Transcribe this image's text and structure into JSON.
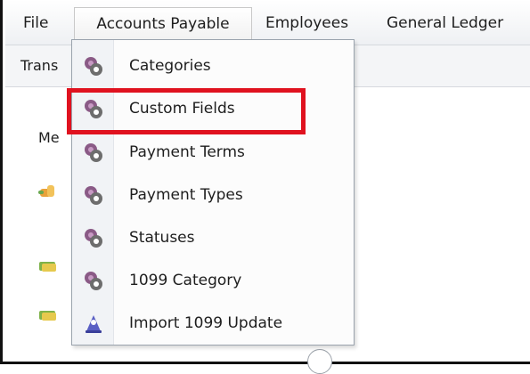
{
  "menubar": {
    "items": [
      {
        "label": "File"
      },
      {
        "label": "Accounts Payable"
      },
      {
        "label": "Employees"
      },
      {
        "label": "General Ledger"
      }
    ]
  },
  "toolbar": {
    "trans_label": "Trans"
  },
  "background": {
    "partial_label": "Me"
  },
  "dropdown": {
    "items": [
      {
        "label": "Categories",
        "icon": "settings-gear-icon"
      },
      {
        "label": "Custom Fields",
        "icon": "settings-gear-icon"
      },
      {
        "label": "Payment Terms",
        "icon": "settings-gear-icon"
      },
      {
        "label": "Payment Types",
        "icon": "settings-gear-icon"
      },
      {
        "label": "Statuses",
        "icon": "settings-gear-icon"
      },
      {
        "label": "1099 Category",
        "icon": "settings-gear-icon"
      },
      {
        "label": "Import 1099 Update",
        "icon": "import-wizard-icon"
      }
    ],
    "highlighted_item": "Custom Fields",
    "highlight_color": "#e0121f"
  }
}
